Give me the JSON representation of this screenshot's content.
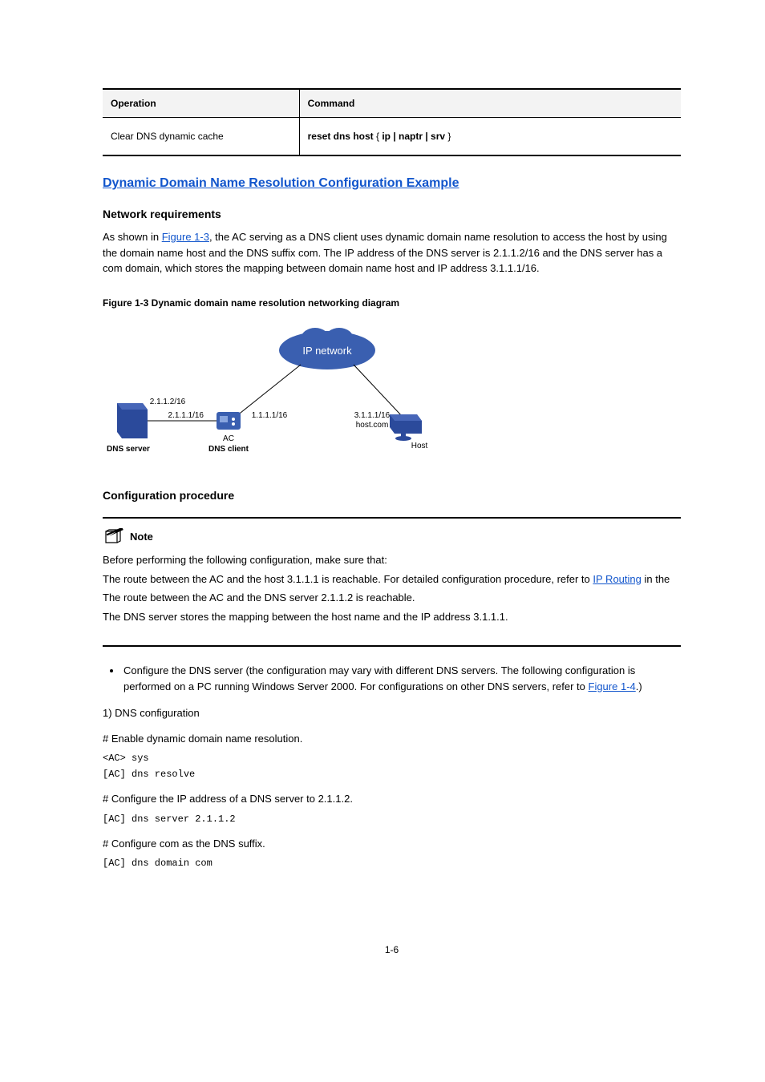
{
  "table": {
    "header_col1": "Operation",
    "header_col2": "Command",
    "row_col1": "Clear DNS dynamic cache",
    "_row_col2_parts": [
      "reset dns host",
      " { ",
      "ip | naptr | srv",
      " } "
    ],
    "row_col2_bold1": "reset dns host",
    "row_col2_plain1": " { ",
    "row_col2_bold2": "ip | naptr | srv",
    "row_col2_plain2": " } "
  },
  "section_dynamic": {
    "title": "Dynamic Domain Name Resolution Configuration Example",
    "nr_title": "Network requirements",
    "nr_para1_plain1": "As shown in ",
    "nr_para1_link": "Figure 1-3",
    "nr_para1_plain2": ", the AC serving as a DNS client uses dynamic domain name resolution to access the host by using the domain name host and the DNS suffix com. The IP address of the DNS server is 2.1.1.2/16 and the DNS server has a com domain, which stores the mapping between domain name host and IP address 3.1.1.1/16.",
    "figure_caption": "Figure 1-3 Dynamic domain name resolution networking diagram",
    "diagram": {
      "ip_network": "IP network",
      "dns_server_ip": "2.1.1.2/16",
      "ac_left_ip": "2.1.1.1/16",
      "ac_right_ip": "1.1.1.1/16",
      "host_ip": "3.1.1.1/16",
      "host_domain": "host.com",
      "dns_server_label": "DNS server",
      "ac_label": "AC",
      "dns_client_label": "DNS client",
      "host_label": "Host"
    },
    "cp_title": "Configuration procedure",
    "note_label": "Note",
    "note_items": [
      {
        "text": "Before performing the following configuration, make sure that:"
      },
      {
        "text": "The route between the AC and the host 3.1.1.1 is reachable. For detailed configuration procedure, refer to ",
        "link": "IP Routing",
        "after": " in the "
      },
      {
        "text": "The route between the AC and the DNS server 2.1.1.2 is reachable."
      },
      {
        "text": "The DNS server stores the mapping between the host name and the IP address 3.1.1.1."
      }
    ],
    "bullet1_before": "Configure the DNS server (the configuration may vary with different DNS servers. The following configuration is performed on a PC running Windows Server 2000. For configurations on other DNS servers, refer to ",
    "bullet1_link": "Figure 1-4",
    "bullet1_after": ".)"
  },
  "section_dns": {
    "title": "1) DNS configuration",
    "steps": [
      {
        "comment": "# Enable dynamic domain name resolution.",
        "cmd1": "<AC> sys",
        "cmd2": "[AC] dns resolve"
      },
      {
        "comment": "# Configure the IP address of a DNS server to 2.1.1.2.",
        "cmd1": "[AC] dns server 2.1.1.2"
      },
      {
        "comment": "# Configure com as the DNS suffix.",
        "cmd1": "[AC] dns domain com"
      }
    ]
  },
  "page_number": "1-6"
}
